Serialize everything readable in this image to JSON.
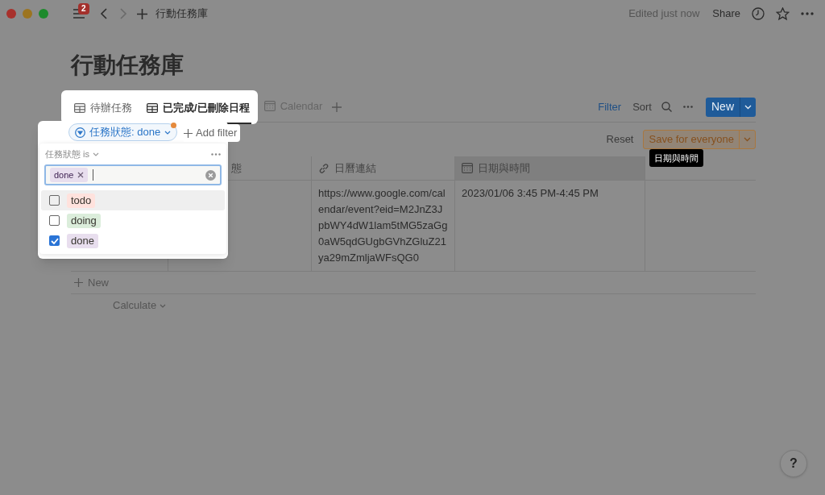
{
  "window": {
    "menu_badge": "2",
    "breadcrumb": "行動任務庫",
    "edited": "Edited just now",
    "share": "Share"
  },
  "page_title": "行動任務庫",
  "views": [
    {
      "label": "待辦任務",
      "kind": "table",
      "selected": false
    },
    {
      "label": "已完成/已刪除日程",
      "kind": "table",
      "selected": true
    },
    {
      "label": "Calendar",
      "kind": "calendar",
      "selected": false
    }
  ],
  "toolbar": {
    "filter": "Filter",
    "sort": "Sort",
    "new": "New"
  },
  "filter_bar": {
    "chip": "任務狀態: done",
    "add_filter": "Add filter",
    "reset": "Reset",
    "save": "Save for everyone"
  },
  "filter_popup": {
    "condition": "任務狀態 is",
    "selected_tag": "done",
    "options": [
      {
        "label": "todo",
        "color": "#ffe2dd",
        "checked": false,
        "selected": true
      },
      {
        "label": "doing",
        "color": "#dbeddb",
        "checked": false,
        "selected": false
      },
      {
        "label": "done",
        "color": "#e8deee",
        "checked": true,
        "selected": false
      }
    ]
  },
  "table": {
    "columns": [
      {
        "label": "態",
        "kind": "text",
        "hovered": false
      },
      {
        "label": "日曆連結",
        "kind": "url",
        "hovered": false
      },
      {
        "label": "日期與時間",
        "kind": "date",
        "hovered": true
      }
    ],
    "rows": [
      {
        "link": "https://www.google.com/calendar/event?eid=M2JnZ3JpbWY4dW1lam5tMG5zaGg0aW5qdGUgbGVhZGluZ21ya29mZmljaWFsQG0",
        "datetime": "2023/01/06 3:45 PM-4:45 PM"
      }
    ],
    "add_row": "New",
    "calculate": "Calculate"
  },
  "tooltip": "日期與時間",
  "help": "?"
}
